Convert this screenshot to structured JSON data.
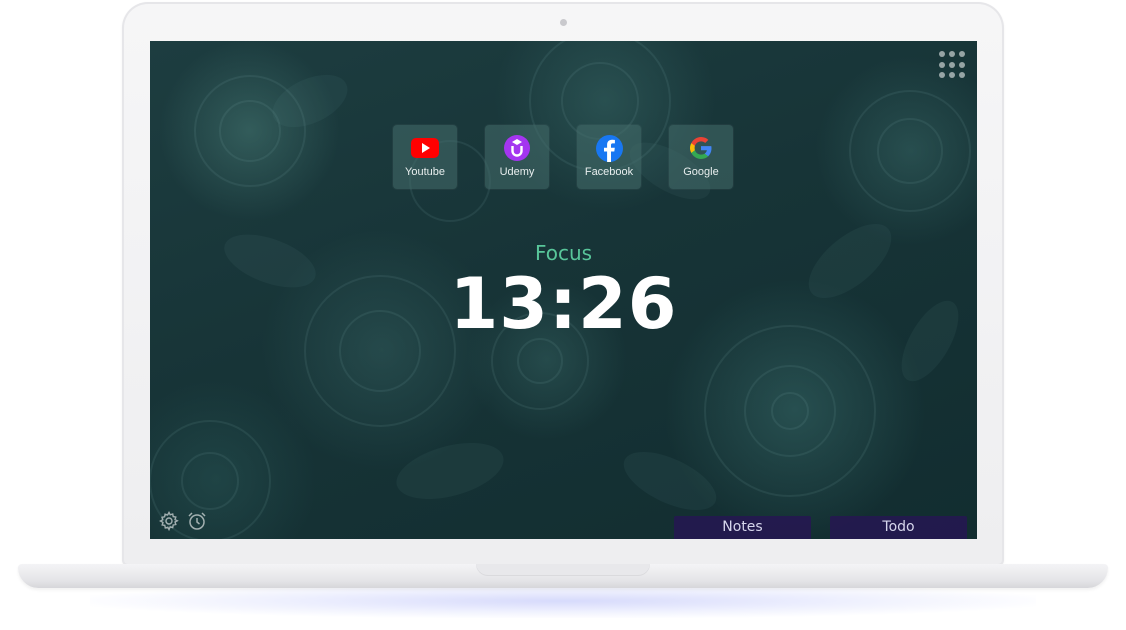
{
  "shortcuts": [
    {
      "label": "Youtube",
      "icon": "youtube-icon",
      "color": "#ff0000"
    },
    {
      "label": "Udemy",
      "icon": "udemy-icon",
      "color": "#a435f0"
    },
    {
      "label": "Facebook",
      "icon": "facebook-icon",
      "color": "#1877f2"
    },
    {
      "label": "Google",
      "icon": "google-icon",
      "color": "#4285f4"
    }
  ],
  "mode": {
    "label": "Focus",
    "color": "#58c69a"
  },
  "clock": {
    "time": "13:26"
  },
  "bottom_bar": {
    "settings_icon": "gear-icon",
    "alarm_icon": "alarm-clock-icon",
    "notes_label": "Notes",
    "todo_label": "Todo"
  },
  "top_right": {
    "icon": "apps-grid-icon"
  }
}
